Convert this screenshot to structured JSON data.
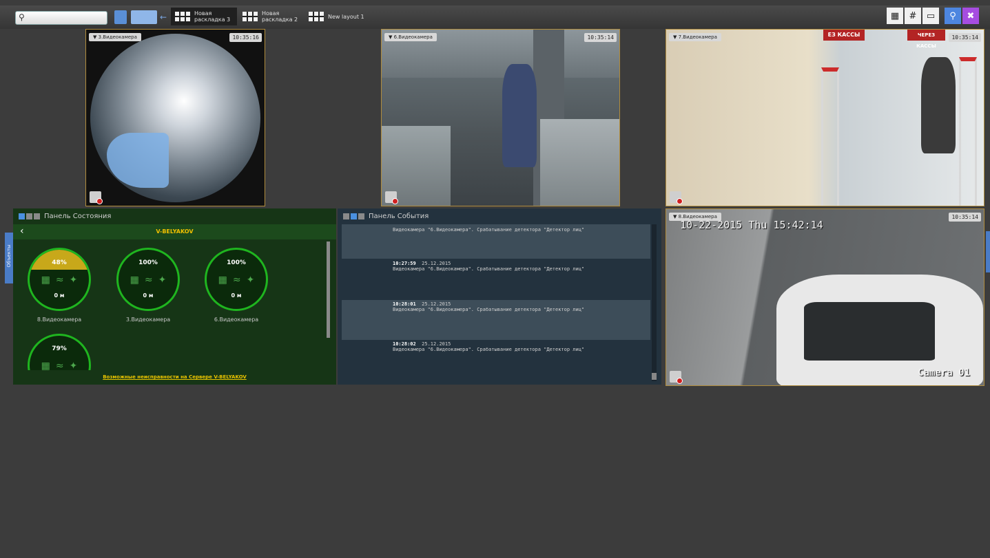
{
  "toolbar": {
    "search_placeholder": "",
    "tabs": [
      {
        "label": "Новая раскладка 3",
        "active": true
      },
      {
        "label": "Новая раскладка 2",
        "active": false
      },
      {
        "label": "New layout 1",
        "active": false
      }
    ],
    "right_icons": [
      "grid-view-icon",
      "hash-grid-icon",
      "single-view-icon",
      "search-icon",
      "tools-icon"
    ]
  },
  "side_tab": {
    "label": "Объекты"
  },
  "cameras": [
    {
      "name": "3.Видеокамера",
      "time": "10:35:16"
    },
    {
      "name": "6.Видеокамера",
      "time": "10:35:14"
    },
    {
      "name": "7.Видеокамера",
      "time": "10:35:14"
    },
    {
      "name": "8.Видеокамера",
      "time": "10:35:14",
      "overlay_date": "10-22-2015 Thu 15:42:14",
      "overlay_label": "Camera 01",
      "sign_text": "ЕЗ КАССЫ",
      "sign_text_2": "ЧЕРЕЗ КАССЫ"
    }
  ],
  "status_panel": {
    "title": "Панель Состояния",
    "server": "V-BELYAKOV",
    "gauges": [
      {
        "percent": "48%",
        "value": "0 м",
        "caption": "8.Видеокамера"
      },
      {
        "percent": "100%",
        "value": "0 м",
        "caption": "3.Видеокамера"
      },
      {
        "percent": "100%",
        "value": "0 м",
        "caption": "6.Видеокамера"
      },
      {
        "percent": "79%",
        "value": "",
        "caption": ""
      }
    ],
    "footer_link": "Возможные неисправности на Сервере V-BELYAKOV"
  },
  "events_panel": {
    "title": "Панель События",
    "events": [
      {
        "time": "",
        "date": "",
        "text": "Видеокамера \"6.Видеокамера\". Срабатывание детектора \"Детектор лиц\""
      },
      {
        "time": "10:27:59",
        "date": "25.12.2015",
        "text": "Видеокамера \"6.Видеокамера\". Срабатывание детектора \"Детектор лиц\""
      },
      {
        "time": "10:28:01",
        "date": "25.12.2015",
        "text": "Видеокамера \"6.Видеокамера\". Срабатывание детектора \"Детектор лиц\""
      },
      {
        "time": "10:28:02",
        "date": "25.12.2015",
        "text": "Видеокамера \"6.Видеокамера\". Срабатывание детектора \"Детектор лиц\""
      }
    ]
  },
  "colors": {
    "accent": "#1fb51f",
    "warning": "#c8a81a",
    "frame": "#b18d3d",
    "link": "#e8c200"
  }
}
